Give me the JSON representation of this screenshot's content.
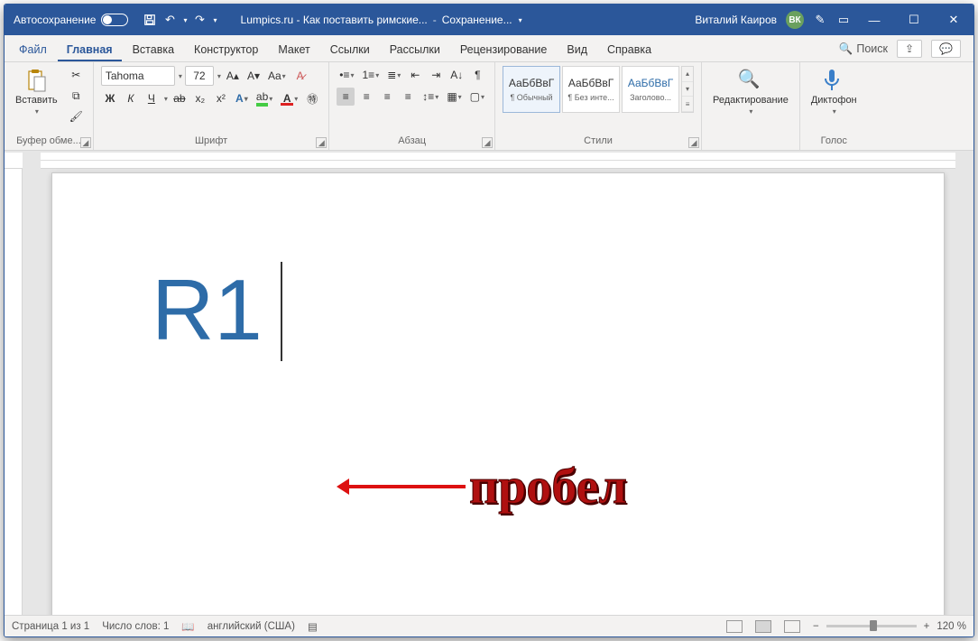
{
  "titlebar": {
    "autosave_label": "Автосохранение",
    "doc_title": "Lumpics.ru - Как поставить римские...",
    "saving_label": "Сохранение...",
    "user_name": "Виталий Каиров",
    "user_initials": "ВК"
  },
  "tabs": {
    "file": "Файл",
    "items": [
      "Главная",
      "Вставка",
      "Конструктор",
      "Макет",
      "Ссылки",
      "Рассылки",
      "Рецензирование",
      "Вид",
      "Справка"
    ],
    "active_index": 0,
    "search_placeholder": "Поиск"
  },
  "ribbon": {
    "clipboard": {
      "paste": "Вставить",
      "group_label": "Буфер обме..."
    },
    "font": {
      "name": "Tahoma",
      "size": "72",
      "bold": "Ж",
      "italic": "К",
      "underline": "Ч",
      "strike": "ab",
      "sub": "x₂",
      "sup": "x²",
      "group_label": "Шрифт"
    },
    "paragraph": {
      "group_label": "Абзац"
    },
    "styles": {
      "items": [
        {
          "preview": "АаБбВвГ",
          "label": "¶ Обычный"
        },
        {
          "preview": "АаБбВвГ",
          "label": "¶ Без инте..."
        },
        {
          "preview": "АаБбВвГ",
          "label": "Заголово..."
        }
      ],
      "group_label": "Стили"
    },
    "editing": {
      "label": "Редактирование"
    },
    "voice": {
      "label": "Диктофон",
      "group_label": "Голос"
    }
  },
  "document": {
    "text": "R1",
    "annotation": "пробел"
  },
  "statusbar": {
    "page": "Страница 1 из 1",
    "words": "Число слов: 1",
    "language": "английский (США)",
    "zoom": "120 %"
  }
}
